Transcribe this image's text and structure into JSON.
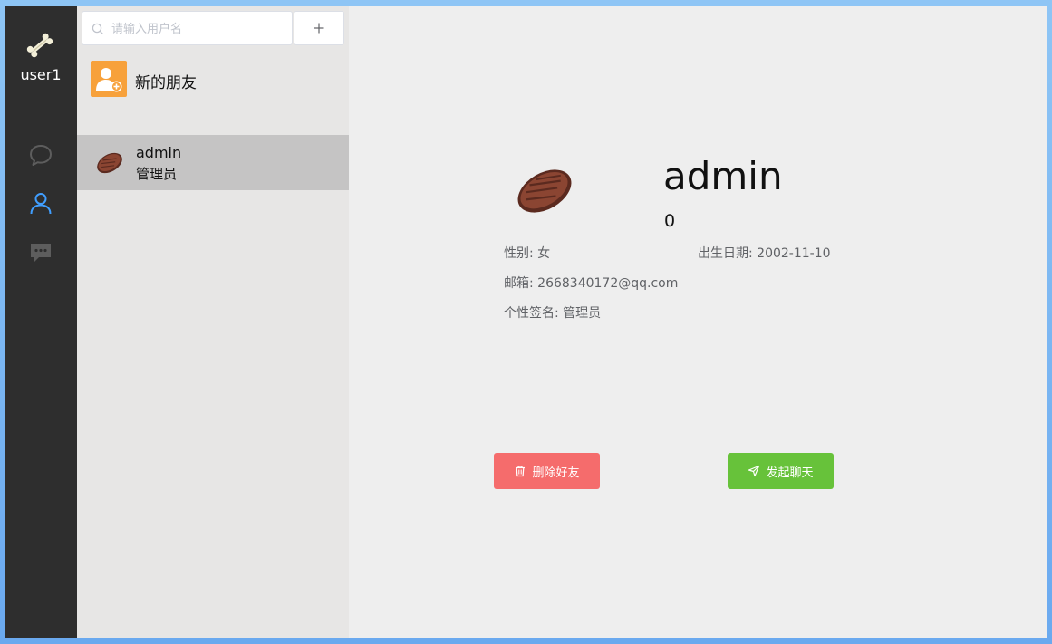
{
  "nav": {
    "username": "user1",
    "avatar_icon": "bone-icon",
    "items": [
      {
        "name": "chat-icon",
        "active": false
      },
      {
        "name": "contacts-icon",
        "active": true
      },
      {
        "name": "comments-icon",
        "active": false
      }
    ],
    "active_color": "#409eff",
    "inactive_color": "#5d5d5d"
  },
  "search": {
    "placeholder": "请输入用户名",
    "value": "",
    "add_label": "+"
  },
  "new_friend": {
    "label": "新的朋友"
  },
  "contacts": [
    {
      "name": "admin",
      "signature": "管理员",
      "selected": true
    }
  ],
  "profile": {
    "name": "admin",
    "id": "0",
    "gender_label": "性别:",
    "gender": "女",
    "birthday_label": "出生日期:",
    "birthday": "2002-11-10",
    "email_label": "邮箱:",
    "email": "2668340172@qq.com",
    "signature_label": "个性签名:",
    "signature": "管理员"
  },
  "actions": {
    "delete_label": "删除好友",
    "chat_label": "发起聊天",
    "delete_color": "#f56c6c",
    "chat_color": "#67c23a"
  }
}
